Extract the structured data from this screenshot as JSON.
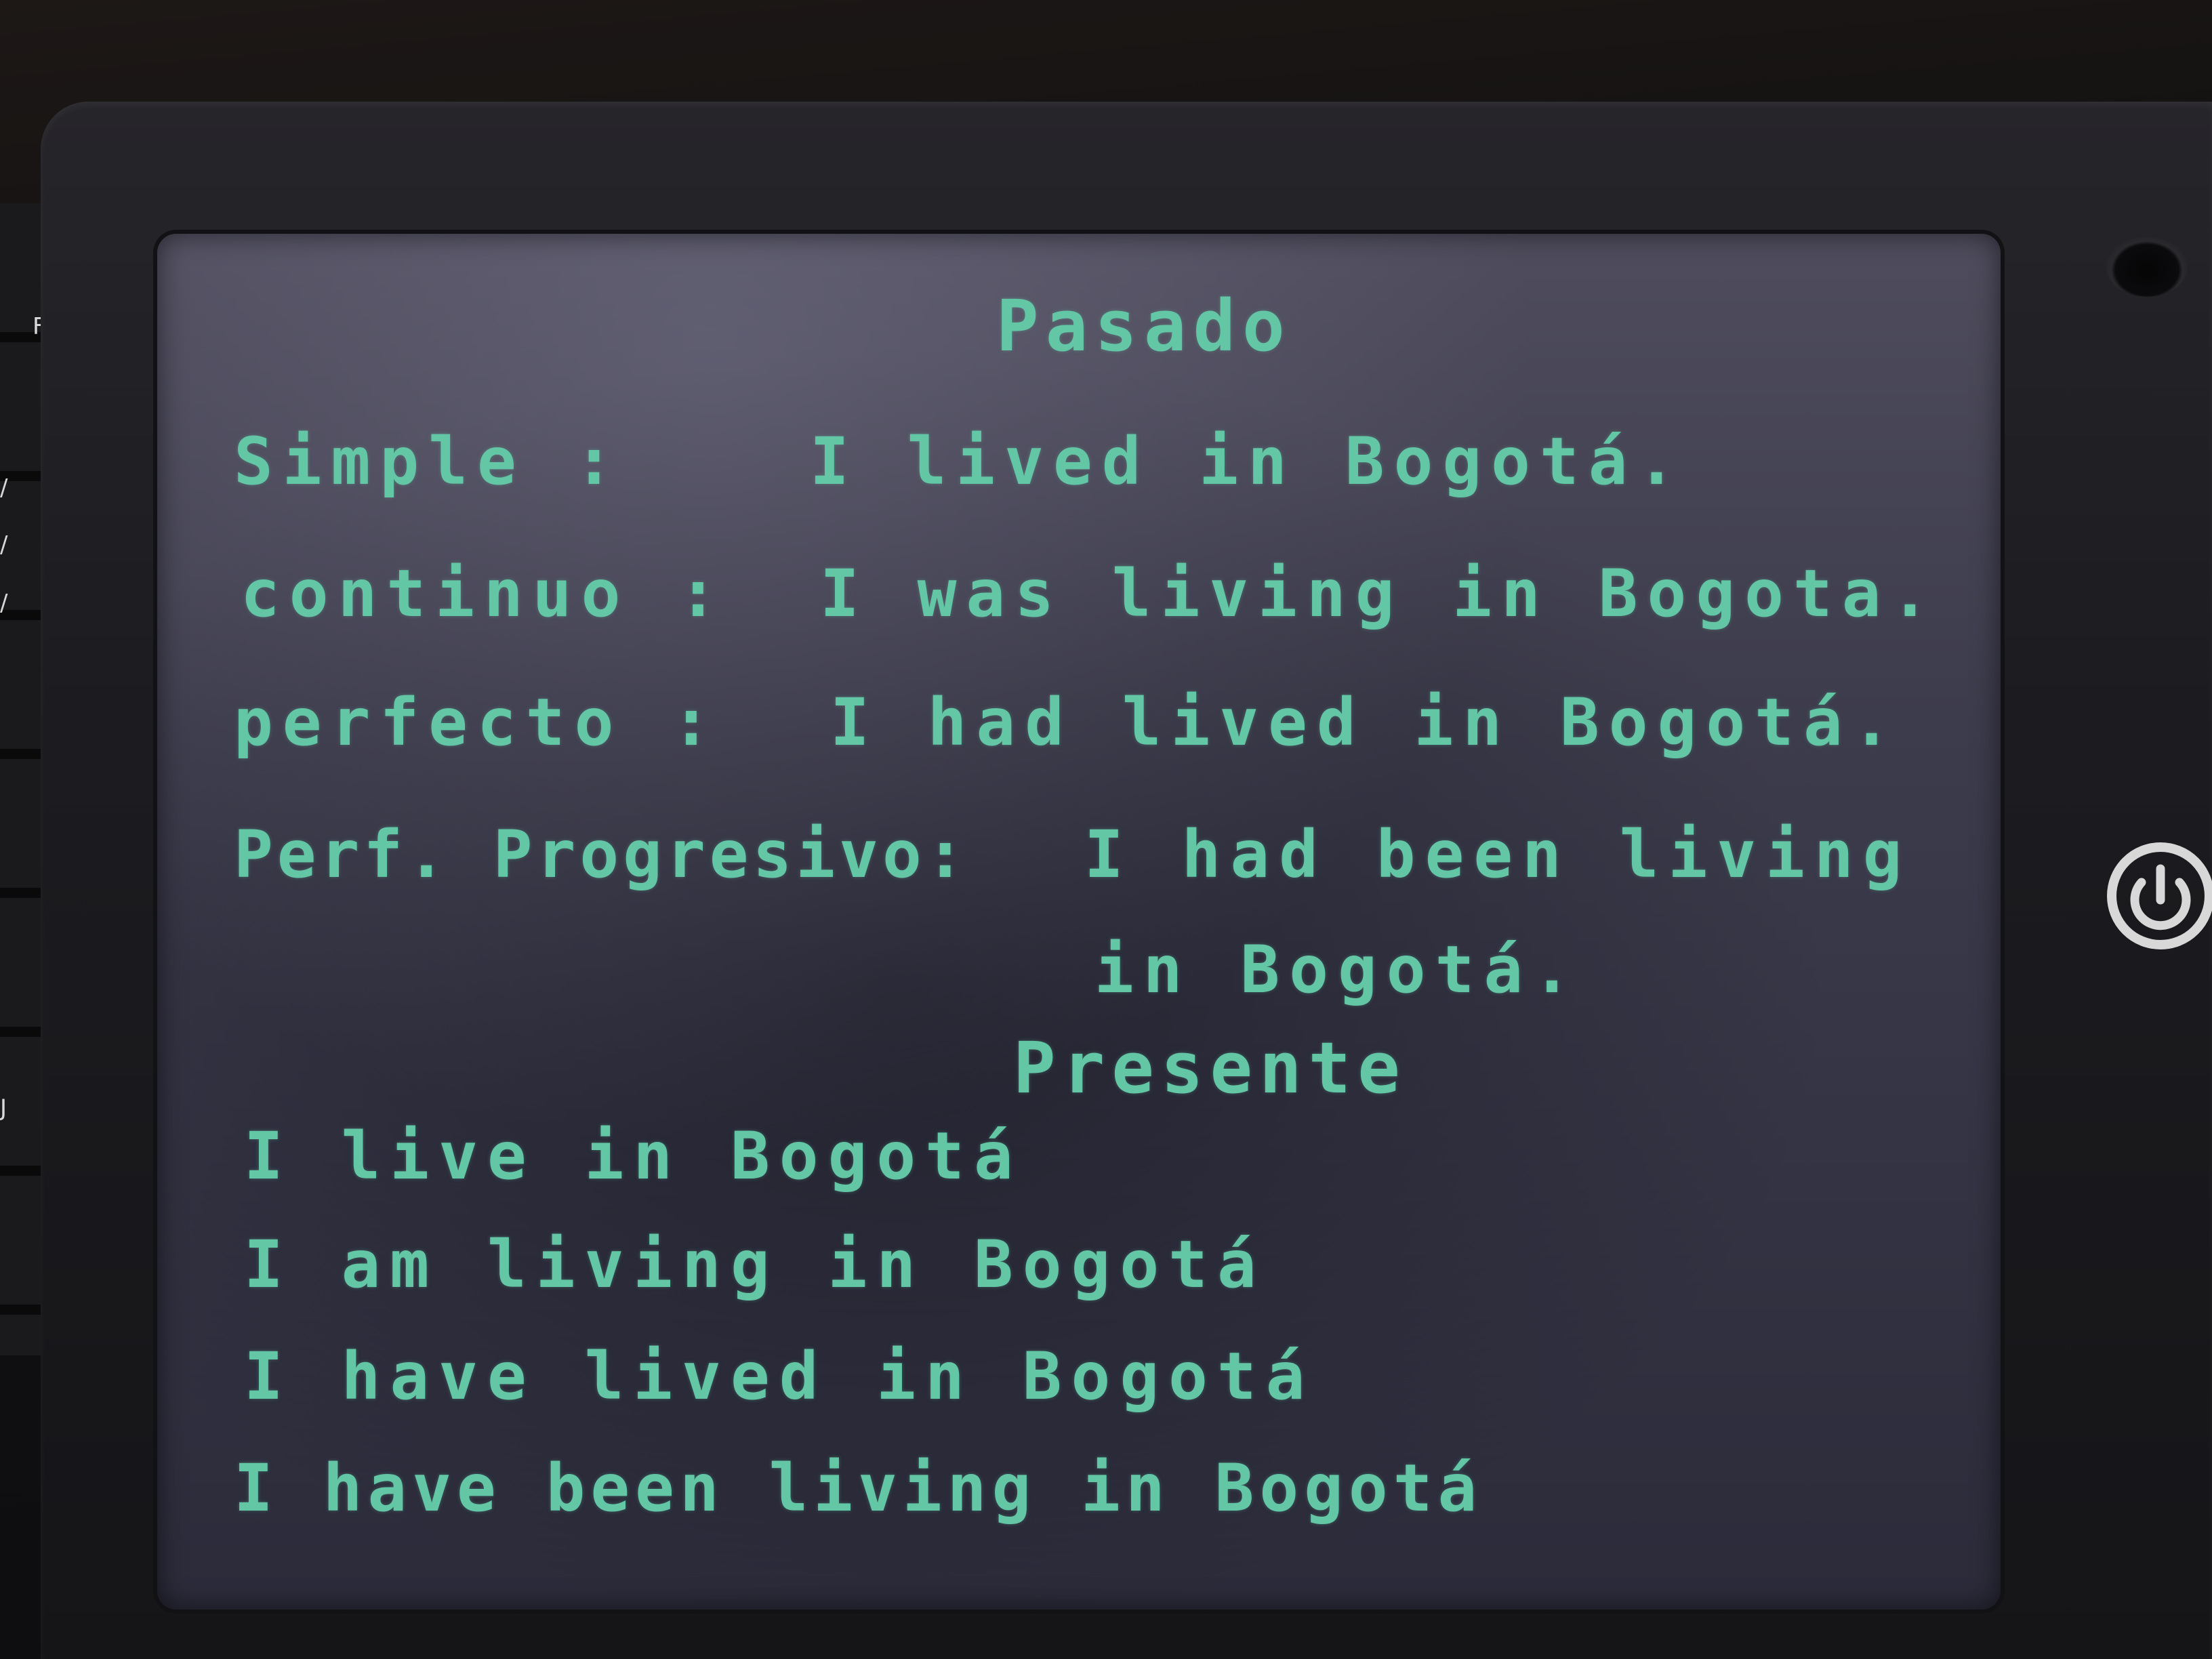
{
  "device": {
    "key_glyphs": [
      "F",
      "/",
      "/",
      "/",
      "J"
    ],
    "ink_color": "#63c7a6",
    "screen_color": "#3d3c4c"
  },
  "board": {
    "pasado": {
      "title": "Pasado",
      "lines": [
        {
          "label": "Simple :",
          "sentence": "I lived in Bogotá."
        },
        {
          "label": "continuo :",
          "sentence": "I was living in Bogota."
        },
        {
          "label": "perfecto :",
          "sentence": "I had lived in Bogotá."
        },
        {
          "label": "Perf. Progresivo:",
          "sentence": "I had been living"
        }
      ],
      "continuation": "in Bogotá."
    },
    "presente": {
      "title": "Presente",
      "lines": [
        "I live in Bogotá",
        "I am living in Bogotá",
        "I have lived in Bogotá",
        "I have been living in Bogotá"
      ]
    }
  }
}
